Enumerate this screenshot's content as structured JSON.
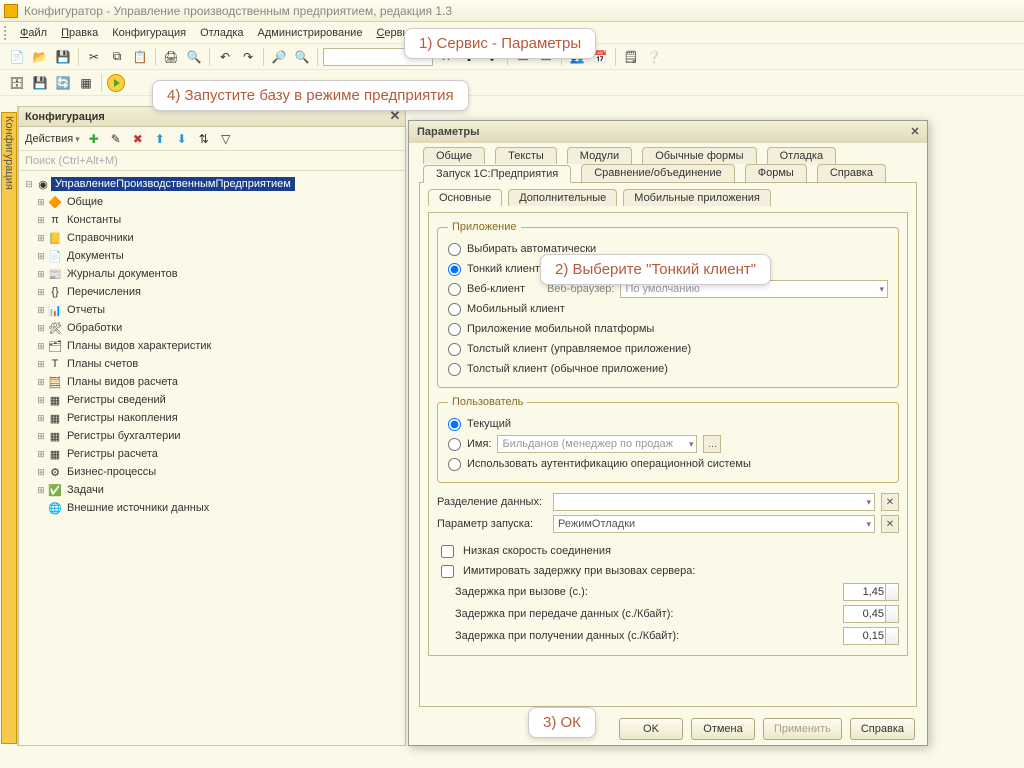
{
  "app": {
    "title": "Конфигуратор - Управление производственным предприятием, редакция 1.3"
  },
  "menu": {
    "file": "Файл",
    "edit": "Правка",
    "config": "Конфигурация",
    "debug": "Отладка",
    "admin": "Администрирование",
    "service": "Сервис"
  },
  "callouts": {
    "c1": "1) Сервис - Параметры",
    "c2": "2) Выберите \"Тонкий клиент\"",
    "c3": "3) ОК",
    "c4": "4) Запустите базу в режиме предприятия"
  },
  "side": {
    "tab1": "Конфигурация"
  },
  "leftpanel": {
    "title": "Конфигурация",
    "actions": "Действия",
    "search_placeholder": "Поиск (Ctrl+Alt+M)",
    "root": "УправлениеПроизводственнымПредприятием",
    "items": [
      {
        "icon": "🔶",
        "label": "Общие"
      },
      {
        "icon": "π",
        "label": "Константы"
      },
      {
        "icon": "📒",
        "label": "Справочники"
      },
      {
        "icon": "📄",
        "label": "Документы"
      },
      {
        "icon": "📰",
        "label": "Журналы документов"
      },
      {
        "icon": "{}",
        "label": "Перечисления"
      },
      {
        "icon": "📊",
        "label": "Отчеты"
      },
      {
        "icon": "🛠",
        "label": "Обработки"
      },
      {
        "icon": "🗂",
        "label": "Планы видов характеристик"
      },
      {
        "icon": "Т",
        "label": "Планы счетов"
      },
      {
        "icon": "🧮",
        "label": "Планы видов расчета"
      },
      {
        "icon": "▦",
        "label": "Регистры сведений"
      },
      {
        "icon": "▦",
        "label": "Регистры накопления"
      },
      {
        "icon": "▦",
        "label": "Регистры бухгалтерии"
      },
      {
        "icon": "▦",
        "label": "Регистры расчета"
      },
      {
        "icon": "⚙",
        "label": "Бизнес-процессы"
      },
      {
        "icon": "✅",
        "label": "Задачи"
      },
      {
        "icon": "🌐",
        "label": "Внешние источники данных"
      }
    ]
  },
  "dialog": {
    "title": "Параметры",
    "tabs_top": [
      "Общие",
      "Тексты",
      "Модули",
      "Обычные формы",
      "Отладка"
    ],
    "tabs_bottom": [
      "Запуск 1С:Предприятия",
      "Сравнение/объединение",
      "Формы",
      "Справка"
    ],
    "active_top": 0,
    "subtabs": [
      "Основные",
      "Дополнительные",
      "Мобильные приложения"
    ],
    "app_group": {
      "legend": "Приложение",
      "opt_auto": "Выбирать автоматически",
      "opt_thin": "Тонкий клиент",
      "opt_web": "Веб-клиент",
      "web_browser_label": "Веб-браузер:",
      "web_browser_value": "По умолчанию",
      "opt_mobile": "Мобильный клиент",
      "opt_mobile_app": "Приложение мобильной платформы",
      "opt_thick_managed": "Толстый клиент (управляемое приложение)",
      "opt_thick_normal": "Толстый клиент (обычное приложение)"
    },
    "user_group": {
      "legend": "Пользователь",
      "opt_current": "Текущий",
      "opt_name": "Имя:",
      "name_value": "Бильданов (менеджер по продаж",
      "opt_osauth": "Использовать аутентификацию операционной системы"
    },
    "data_sep_label": "Разделение данных:",
    "start_param_label": "Параметр запуска:",
    "start_param_value": "РежимОтладки",
    "chk_slow": "Низкая скорость соединения",
    "chk_simdelay": "Имитировать задержку при вызовах сервера:",
    "delay_call_label": "Задержка при вызове (с.):",
    "delay_call_value": "1,45",
    "delay_send_label": "Задержка при передаче данных (с./Кбайт):",
    "delay_send_value": "0,45",
    "delay_recv_label": "Задержка при получении данных (с./Кбайт):",
    "delay_recv_value": "0,15",
    "btn_ok": "OK",
    "btn_cancel": "Отмена",
    "btn_apply": "Применить",
    "btn_help": "Справка"
  }
}
